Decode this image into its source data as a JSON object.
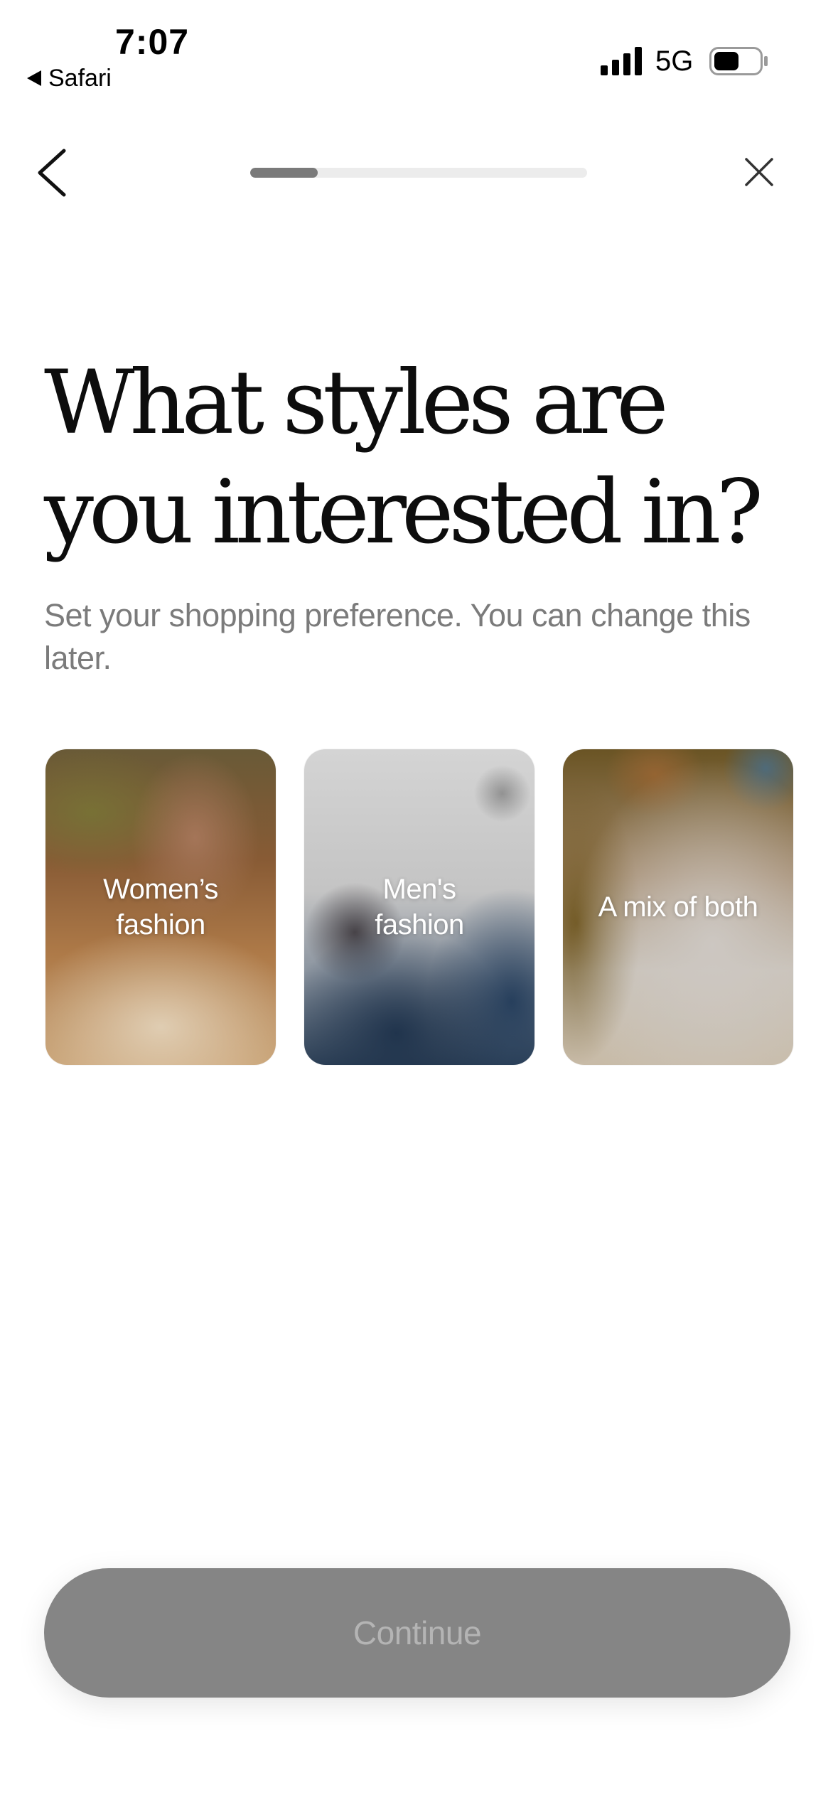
{
  "status_bar": {
    "time": "7:07",
    "back_app": "Safari",
    "network": "5G",
    "battery_level": 0.55
  },
  "nav": {
    "progress_fraction": 0.2
  },
  "content": {
    "title": "What styles are you interested in?",
    "subtitle": "Set your shopping preference. You can change this later."
  },
  "options": [
    {
      "label": "Women’s\nfashion"
    },
    {
      "label": "Men's\nfashion"
    },
    {
      "label": "A mix of both"
    }
  ],
  "footer": {
    "continue_label": "Continue"
  },
  "colors": {
    "progress_track": "#ececec",
    "progress_fill": "#7a7a7a",
    "continue_bg": "#858585",
    "continue_text": "#b4b4b4",
    "subtitle": "#7b7b7b"
  },
  "icons": {
    "nav_back": "chevron-left-icon",
    "nav_close": "close-icon",
    "signal": "cellular-signal-icon",
    "battery": "battery-icon",
    "back_app": "back-triangle-icon"
  }
}
